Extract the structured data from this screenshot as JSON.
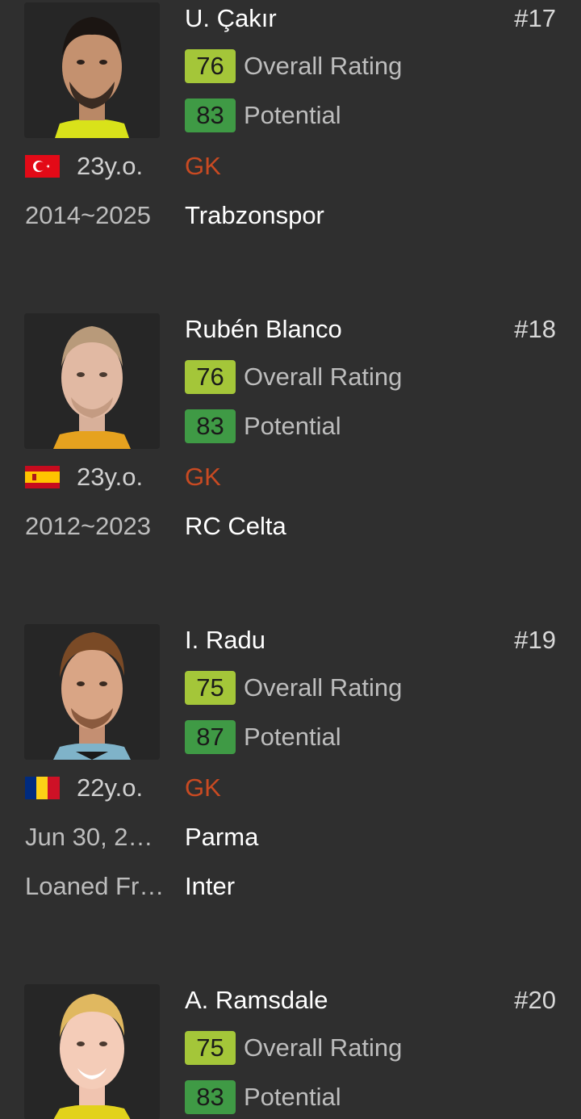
{
  "colors": {
    "background": "#2f2f2f",
    "overall_badge": "#a4c639",
    "potential_badge": "#3f9a45",
    "position": "#c94a22"
  },
  "players": [
    {
      "name": "U. Çakır",
      "number": "#17",
      "overall": "76",
      "overall_label": "Overall Rating",
      "potential": "83",
      "potential_label": "Potential",
      "flag": "turkey-flag",
      "age": "23y.o.",
      "position": "GK",
      "contract": "2014~2025",
      "club": "Trabzonspor"
    },
    {
      "name": "Rubén Blanco",
      "number": "#18",
      "overall": "76",
      "overall_label": "Overall Rating",
      "potential": "83",
      "potential_label": "Potential",
      "flag": "spain-flag",
      "age": "23y.o.",
      "position": "GK",
      "contract": "2012~2023",
      "club": "RC Celta"
    },
    {
      "name": "I. Radu",
      "number": "#19",
      "overall": "75",
      "overall_label": "Overall Rating",
      "potential": "87",
      "potential_label": "Potential",
      "flag": "romania-flag",
      "age": "22y.o.",
      "position": "GK",
      "contract": "Jun 30, 2…",
      "club": "Parma",
      "loan_label": "Loaned Fr…",
      "loan_club": "Inter"
    },
    {
      "name": "A. Ramsdale",
      "number": "#20",
      "overall": "75",
      "overall_label": "Overall Rating",
      "potential": "83",
      "potential_label": "Potential"
    }
  ]
}
